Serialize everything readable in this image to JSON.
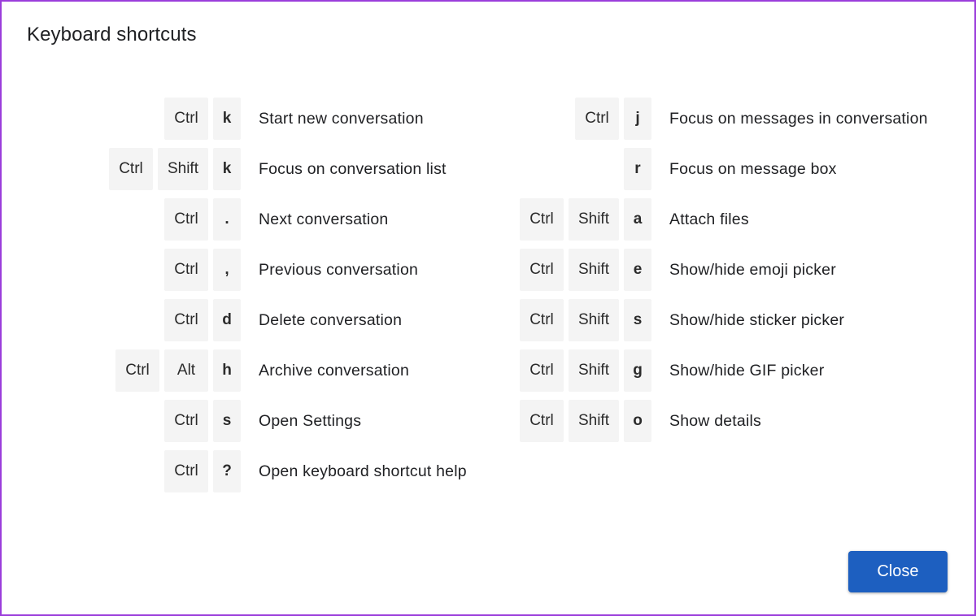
{
  "dialog": {
    "title": "Keyboard shortcuts",
    "close_label": "Close",
    "accent_color": "#1d5fc0",
    "border_color": "#9b3ddb"
  },
  "left_shortcuts": [
    {
      "modifiers": [
        "Ctrl"
      ],
      "key": "k",
      "description": "Start new conversation"
    },
    {
      "modifiers": [
        "Ctrl",
        "Shift"
      ],
      "key": "k",
      "description": "Focus on conversation list"
    },
    {
      "modifiers": [
        "Ctrl"
      ],
      "key": ".",
      "description": "Next conversation"
    },
    {
      "modifiers": [
        "Ctrl"
      ],
      "key": ",",
      "description": "Previous conversation"
    },
    {
      "modifiers": [
        "Ctrl"
      ],
      "key": "d",
      "description": "Delete conversation"
    },
    {
      "modifiers": [
        "Ctrl",
        "Alt"
      ],
      "key": "h",
      "description": "Archive conversation"
    },
    {
      "modifiers": [
        "Ctrl"
      ],
      "key": "s",
      "description": "Open Settings"
    },
    {
      "modifiers": [
        "Ctrl"
      ],
      "key": "?",
      "description": "Open keyboard shortcut help"
    }
  ],
  "right_shortcuts": [
    {
      "modifiers": [
        "Ctrl"
      ],
      "key": "j",
      "description": "Focus on messages in conversation"
    },
    {
      "modifiers": [],
      "key": "r",
      "description": "Focus on message box"
    },
    {
      "modifiers": [
        "Ctrl",
        "Shift"
      ],
      "key": "a",
      "description": "Attach files"
    },
    {
      "modifiers": [
        "Ctrl",
        "Shift"
      ],
      "key": "e",
      "description": "Show/hide emoji picker"
    },
    {
      "modifiers": [
        "Ctrl",
        "Shift"
      ],
      "key": "s",
      "description": "Show/hide sticker picker"
    },
    {
      "modifiers": [
        "Ctrl",
        "Shift"
      ],
      "key": "g",
      "description": "Show/hide GIF picker"
    },
    {
      "modifiers": [
        "Ctrl",
        "Shift"
      ],
      "key": "o",
      "description": "Show details"
    }
  ]
}
